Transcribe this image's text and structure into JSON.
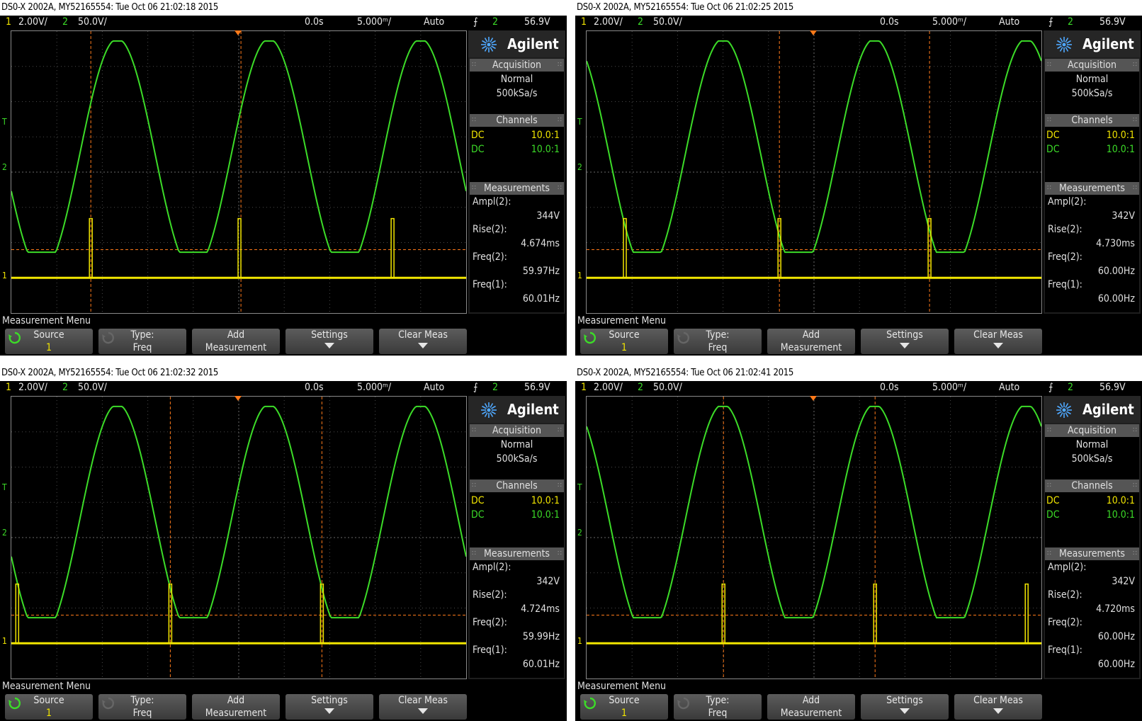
{
  "scopes": [
    {
      "title": "DS0-X 2002A, MY52165554: Tue Oct 06 21:02:18 2015",
      "ch1_num": "1",
      "ch1_scale": "2.00V/",
      "ch2_num": "2",
      "ch2_scale": "50.0V/",
      "delay": "0.0s",
      "timebase": "5.000ᵐ/",
      "trig_mode": "Auto",
      "trig_src": "2",
      "trig_level": "56.9V",
      "brand": "Agilent",
      "acq_head": "Acquisition",
      "acq_mode": "Normal",
      "acq_rate": "500kSa/s",
      "ch_head": "Channels",
      "ch1_coupling": "DC",
      "ch1_ratio": "10.0:1",
      "ch2_coupling": "DC",
      "ch2_ratio": "10.0:1",
      "meas_head": "Measurements",
      "meas": [
        {
          "label": "Ampl(2):",
          "value": "344V"
        },
        {
          "label": "Rise(2):",
          "value": "4.674ms"
        },
        {
          "label": "Freq(2):",
          "value": "59.97Hz"
        },
        {
          "label": "Freq(1):",
          "value": "60.01Hz"
        }
      ],
      "menu_title": "Measurement Menu",
      "softkeys": [
        {
          "l1": "Source",
          "l2": "1"
        },
        {
          "l1": "Type:",
          "l2": "Freq"
        },
        {
          "l1": "Add",
          "l2": "Measurement"
        },
        {
          "l1": "Settings",
          "l2": ""
        },
        {
          "l1": "Clear Meas",
          "l2": ""
        }
      ],
      "markers": {
        "trigger": "T",
        "ch2_ref": "2",
        "ch1_ref": "1"
      },
      "trace": {
        "sine_phase_deg": 180,
        "pulse_times_ms": [
          5.4,
          15.5,
          25.9
        ],
        "cursor_times_ms": [
          5.4,
          15.6
        ]
      }
    },
    {
      "title": "DS0-X 2002A, MY52165554: Tue Oct 06 21:02:25 2015",
      "ch1_num": "1",
      "ch1_scale": "2.00V/",
      "ch2_num": "2",
      "ch2_scale": "50.0V/",
      "delay": "0.0s",
      "timebase": "5.000ᵐ/",
      "trig_mode": "Auto",
      "trig_src": "2",
      "trig_level": "56.9V",
      "brand": "Agilent",
      "acq_head": "Acquisition",
      "acq_mode": "Normal",
      "acq_rate": "500kSa/s",
      "ch_head": "Channels",
      "ch1_coupling": "DC",
      "ch1_ratio": "10.0:1",
      "ch2_coupling": "DC",
      "ch2_ratio": "10.0:1",
      "meas_head": "Measurements",
      "meas": [
        {
          "label": "Ampl(2):",
          "value": "342V"
        },
        {
          "label": "Rise(2):",
          "value": "4.730ms"
        },
        {
          "label": "Freq(2):",
          "value": "60.00Hz"
        },
        {
          "label": "Freq(1):",
          "value": "60.00Hz"
        }
      ],
      "menu_title": "Measurement Menu",
      "softkeys": [
        {
          "l1": "Source",
          "l2": "1"
        },
        {
          "l1": "Type:",
          "l2": "Freq"
        },
        {
          "l1": "Add",
          "l2": "Measurement"
        },
        {
          "l1": "Settings",
          "l2": ""
        },
        {
          "l1": "Clear Meas",
          "l2": ""
        }
      ],
      "markers": {
        "trigger": "T",
        "ch2_ref": "2",
        "ch1_ref": "1"
      },
      "trace": {
        "sine_phase_deg": 180,
        "pulse_times_ms": [
          2.6,
          13.1,
          23.3
        ],
        "cursor_times_ms": [
          13.1,
          23.3
        ]
      }
    },
    {
      "title": "DS0-X 2002A, MY52165554: Tue Oct 06 21:02:32 2015",
      "ch1_num": "1",
      "ch1_scale": "2.00V/",
      "ch2_num": "2",
      "ch2_scale": "50.0V/",
      "delay": "0.0s",
      "timebase": "5.000ᵐ/",
      "trig_mode": "Auto",
      "trig_src": "2",
      "trig_level": "56.9V",
      "brand": "Agilent",
      "acq_head": "Acquisition",
      "acq_mode": "Normal",
      "acq_rate": "500kSa/s",
      "ch_head": "Channels",
      "ch1_coupling": "DC",
      "ch1_ratio": "10.0:1",
      "ch2_coupling": "DC",
      "ch2_ratio": "10.0:1",
      "meas_head": "Measurements",
      "meas": [
        {
          "label": "Ampl(2):",
          "value": "342V"
        },
        {
          "label": "Rise(2):",
          "value": "4.724ms"
        },
        {
          "label": "Freq(2):",
          "value": "59.99Hz"
        },
        {
          "label": "Freq(1):",
          "value": "60.01Hz"
        }
      ],
      "menu_title": "Measurement Menu",
      "softkeys": [
        {
          "l1": "Source",
          "l2": "1"
        },
        {
          "l1": "Type:",
          "l2": "Freq"
        },
        {
          "l1": "Add",
          "l2": "Measurement"
        },
        {
          "l1": "Settings",
          "l2": ""
        },
        {
          "l1": "Clear Meas",
          "l2": ""
        }
      ],
      "markers": {
        "trigger": "T",
        "ch2_ref": "2",
        "ch1_ref": "1"
      },
      "trace": {
        "sine_phase_deg": 180,
        "pulse_times_ms": [
          0.4,
          10.8,
          21.1
        ],
        "cursor_times_ms": [
          10.8,
          21.1
        ]
      }
    },
    {
      "title": "DS0-X 2002A, MY52165554: Tue Oct 06 21:02:41 2015",
      "ch1_num": "1",
      "ch1_scale": "2.00V/",
      "ch2_num": "2",
      "ch2_scale": "50.0V/",
      "delay": "0.0s",
      "timebase": "5.000ᵐ/",
      "trig_mode": "Auto",
      "trig_src": "2",
      "trig_level": "56.9V",
      "brand": "Agilent",
      "acq_head": "Acquisition",
      "acq_mode": "Normal",
      "acq_rate": "500kSa/s",
      "ch_head": "Channels",
      "ch1_coupling": "DC",
      "ch1_ratio": "10.0:1",
      "ch2_coupling": "DC",
      "ch2_ratio": "10.0:1",
      "meas_head": "Measurements",
      "meas": [
        {
          "label": "Ampl(2):",
          "value": "342V"
        },
        {
          "label": "Rise(2):",
          "value": "4.720ms"
        },
        {
          "label": "Freq(2):",
          "value": "60.00Hz"
        },
        {
          "label": "Freq(1):",
          "value": "60.00Hz"
        }
      ],
      "menu_title": "Measurement Menu",
      "softkeys": [
        {
          "l1": "Source",
          "l2": "1"
        },
        {
          "l1": "Type:",
          "l2": "Freq"
        },
        {
          "l1": "Add",
          "l2": "Measurement"
        },
        {
          "l1": "Settings",
          "l2": ""
        },
        {
          "l1": "Clear Meas",
          "l2": ""
        }
      ],
      "markers": {
        "trigger": "T",
        "ch2_ref": "2",
        "ch1_ref": "1"
      },
      "trace": {
        "sine_phase_deg": 180,
        "pulse_times_ms": [
          9.3,
          19.6,
          29.9
        ],
        "cursor_times_ms": [
          9.3,
          19.6
        ]
      }
    }
  ],
  "colors": {
    "ch1": "#f2e600",
    "ch2": "#3cdc28",
    "cursor": "#ff7a1a",
    "grid": "#4a4a4a"
  }
}
